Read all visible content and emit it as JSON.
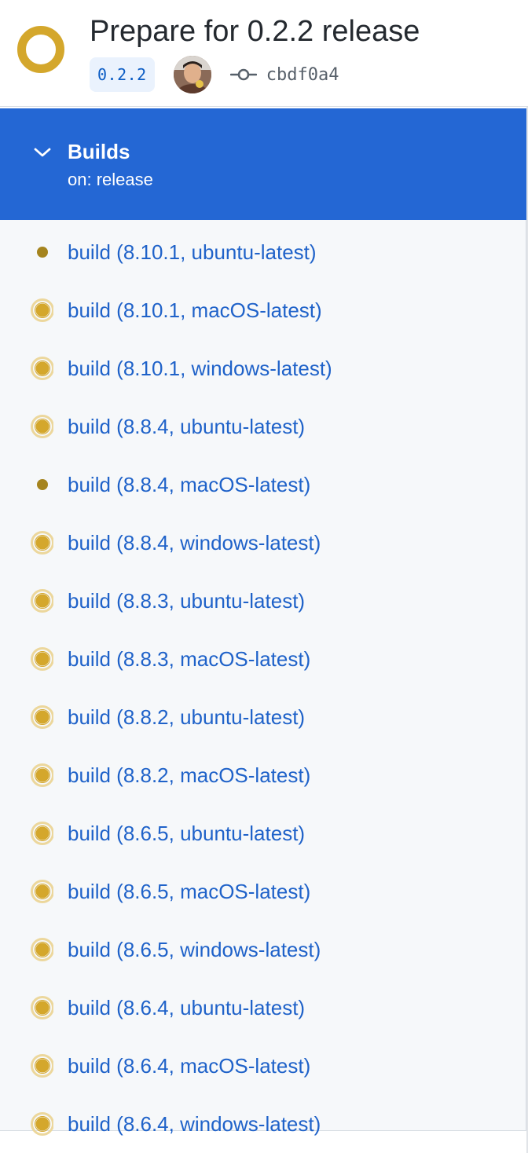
{
  "header": {
    "title": "Prepare for 0.2.2 release",
    "tag": "0.2.2",
    "commit_sha": "cbdf0a4",
    "status_icon": "in-progress-ring-icon",
    "status_color": "#d4a72c"
  },
  "workflow": {
    "name": "Builds",
    "trigger": "on: release",
    "expanded": true,
    "background_color": "#2467d4"
  },
  "jobs": [
    {
      "label": "build (8.10.1, ubuntu-latest)",
      "status": "queued"
    },
    {
      "label": "build (8.10.1, macOS-latest)",
      "status": "in_progress"
    },
    {
      "label": "build (8.10.1, windows-latest)",
      "status": "in_progress"
    },
    {
      "label": "build (8.8.4, ubuntu-latest)",
      "status": "in_progress"
    },
    {
      "label": "build (8.8.4, macOS-latest)",
      "status": "queued"
    },
    {
      "label": "build (8.8.4, windows-latest)",
      "status": "in_progress"
    },
    {
      "label": "build (8.8.3, ubuntu-latest)",
      "status": "in_progress"
    },
    {
      "label": "build (8.8.3, macOS-latest)",
      "status": "in_progress"
    },
    {
      "label": "build (8.8.2, ubuntu-latest)",
      "status": "in_progress"
    },
    {
      "label": "build (8.8.2, macOS-latest)",
      "status": "in_progress"
    },
    {
      "label": "build (8.6.5, ubuntu-latest)",
      "status": "in_progress"
    },
    {
      "label": "build (8.6.5, macOS-latest)",
      "status": "in_progress"
    },
    {
      "label": "build (8.6.5, windows-latest)",
      "status": "in_progress"
    },
    {
      "label": "build (8.6.4, ubuntu-latest)",
      "status": "in_progress"
    },
    {
      "label": "build (8.6.4, macOS-latest)",
      "status": "in_progress"
    },
    {
      "label": "build (8.6.4, windows-latest)",
      "status": "in_progress"
    }
  ],
  "colors": {
    "link": "#1f62c9",
    "pending": "#d4a72c",
    "queued": "#a5841e"
  }
}
